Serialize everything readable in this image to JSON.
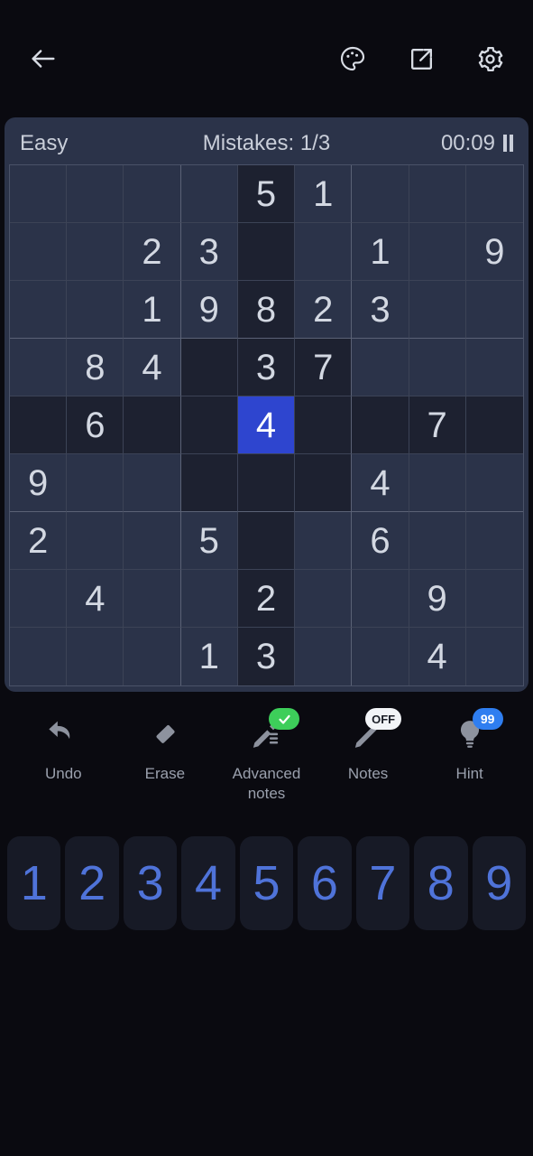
{
  "header": {
    "back_icon": "arrow-left-icon",
    "theme_icon": "palette-icon",
    "share_icon": "share-external-icon",
    "settings_icon": "gear-icon"
  },
  "status": {
    "difficulty": "Easy",
    "mistakes": "Mistakes: 1/3",
    "timer": "00:09",
    "pause_icon": "pause-icon"
  },
  "board": {
    "selected": {
      "row": 4,
      "col": 4,
      "value": "4"
    },
    "rows": [
      [
        "",
        "",
        "",
        "",
        "5",
        "1",
        "",
        "",
        ""
      ],
      [
        "",
        "",
        "2",
        "3",
        "",
        "",
        "1",
        "",
        "9"
      ],
      [
        "",
        "",
        "1",
        "9",
        "8",
        "2",
        "3",
        "",
        ""
      ],
      [
        "",
        "8",
        "4",
        "",
        "3",
        "7",
        "",
        "",
        ""
      ],
      [
        "",
        "6",
        "",
        "",
        "4",
        "",
        "",
        "7",
        ""
      ],
      [
        "9",
        "",
        "",
        "",
        "",
        "",
        "4",
        "",
        ""
      ],
      [
        "2",
        "",
        "",
        "5",
        "",
        "",
        "6",
        "",
        ""
      ],
      [
        "",
        "4",
        "",
        "",
        "2",
        "",
        "",
        "9",
        ""
      ],
      [
        "",
        "",
        "",
        "1",
        "3",
        "",
        "",
        "4",
        ""
      ]
    ]
  },
  "tools": [
    {
      "label": "Undo",
      "icon": "undo-icon",
      "badge": null,
      "badge_type": null
    },
    {
      "label": "Erase",
      "icon": "eraser-icon",
      "badge": null,
      "badge_type": null
    },
    {
      "label": "Advanced notes",
      "icon": "advanced-notes-pencil-icon",
      "badge": "check",
      "badge_type": "green"
    },
    {
      "label": "Notes",
      "icon": "pencil-icon",
      "badge": "OFF",
      "badge_type": "white"
    },
    {
      "label": "Hint",
      "icon": "lightbulb-icon",
      "badge": "99",
      "badge_type": "blue"
    }
  ],
  "numpad": [
    "1",
    "2",
    "3",
    "4",
    "5",
    "6",
    "7",
    "8",
    "9"
  ],
  "colors": {
    "page_background": "#0a0a10",
    "board_background": "#2b3349",
    "cell_background": "#2b3349",
    "cell_highlight": "#1d2130",
    "selected_cell": "#2e45cf",
    "number_text": "#d3d8e2",
    "numpad_text": "#4f73d9",
    "numpad_key": "#171a26",
    "badge_green": "#3dce5a",
    "badge_blue": "#2f7ef0",
    "badge_white": "#f2f4f7"
  }
}
